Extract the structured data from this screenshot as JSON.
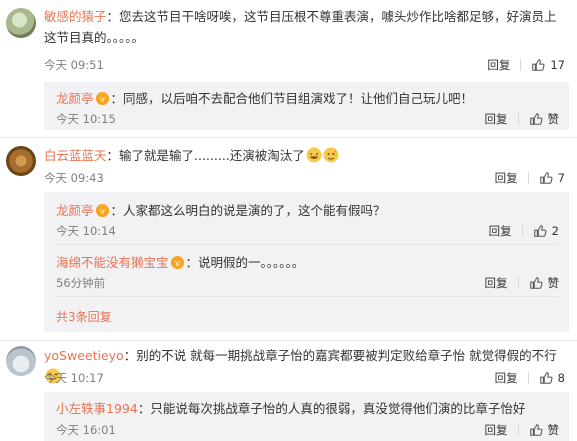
{
  "comments": [
    {
      "user": "敏感的猿子",
      "text": "：您去这节目干啥呀唉，这节目压根不尊重表演，噱头炒作比啥都足够，好演员上这节目真的。。。。。",
      "time": "今天 09:51",
      "reply_label": "回复",
      "likes": "17",
      "replies": [
        {
          "user": "龙颜亭",
          "text": "：同感，以后咱不去配合他们节目组演戏了！让他们自己玩儿吧！",
          "time": "今天 10:15",
          "reply_label": "回复",
          "like_label": "赞"
        }
      ]
    },
    {
      "user": "白云蓝蓝天",
      "text": "：输了就是输了.........还演被淘汰了",
      "time": "今天 09:43",
      "reply_label": "回复",
      "likes": "7",
      "replies": [
        {
          "user": "龙颜亭",
          "text": "：人家都这么明白的说是演的了，这个能有假吗？",
          "time": "今天 10:14",
          "reply_label": "回复",
          "likes": "2"
        },
        {
          "user": "海绵不能没有獭宝宝",
          "text": "：说明假的一。。。。。。",
          "time": "56分钟前",
          "reply_label": "回复",
          "like_label": "赞"
        }
      ],
      "more": "共3条回复"
    },
    {
      "user": "yoSweetieyo",
      "text": "：别的不说 就每一期挑战章子怡的嘉宾都要被判定败给章子怡 就觉得假的不行",
      "time": "今天 10:17",
      "reply_label": "回复",
      "likes": "8",
      "replies": [
        {
          "user": "小左轶事1994",
          "text": "：只能说每次挑战章子怡的人真的很弱，真没觉得他们演的比章子怡好",
          "time": "今天 16:01",
          "reply_label": "回复",
          "like_label": "赞"
        }
      ]
    }
  ],
  "colors": {
    "username": "#eb7350",
    "meta": "#808080",
    "reply_bg": "#f2f2f5"
  },
  "icons": {
    "like": "thumbs-up-icon",
    "vip": "vip-badge-icon",
    "laugh_emoji": "laugh-emoji-icon",
    "sweat_emoji": "sweat-emoji-icon",
    "smirk_emoji": "smirk-emoji-icon"
  }
}
